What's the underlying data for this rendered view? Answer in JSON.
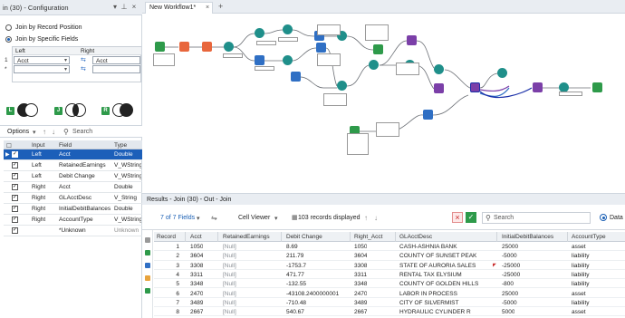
{
  "config": {
    "title": "in (30) - Configuration",
    "radio_record": "Join by Record Position",
    "radio_fields": "Join by Specific Fields",
    "join_table": {
      "col_left": "Left",
      "col_right": "Right",
      "rows": [
        {
          "num": "1",
          "left": "Acct",
          "right": "Acct"
        },
        {
          "num": "*",
          "left": "",
          "right": ""
        }
      ]
    },
    "venn_tags": [
      "L",
      "J",
      "R"
    ],
    "options_label": "Options",
    "search_label": "Search",
    "field_headers": {
      "input": "Input",
      "field": "Field",
      "type": "Type"
    },
    "fields": [
      {
        "input": "Left",
        "field": "Acct",
        "type": "Double",
        "checked": true,
        "selected": true
      },
      {
        "input": "Left",
        "field": "RetainedEarnings",
        "type": "V_WString",
        "checked": true
      },
      {
        "input": "Left",
        "field": "Debit Change",
        "type": "V_WString",
        "checked": true
      },
      {
        "input": "Right",
        "field": "Acct",
        "type": "Double",
        "checked": true
      },
      {
        "input": "Right",
        "field": "GLAcctDesc",
        "type": "V_String",
        "checked": true
      },
      {
        "input": "Right",
        "field": "InitialDebitBalances",
        "type": "Double",
        "checked": true
      },
      {
        "input": "Right",
        "field": "AccountType",
        "type": "V_WString",
        "checked": true
      },
      {
        "input": "",
        "field": "*Unknown",
        "type": "Unknown",
        "checked": true
      }
    ]
  },
  "tabs": {
    "workflow": "New Workflow1*",
    "add": "+"
  },
  "results": {
    "title": "Results - Join (30) - Out - Join",
    "fields_label": "7 of 7 Fields",
    "viewer_label": "Cell Viewer",
    "records_label": "103 records displayed",
    "search_label": "Search",
    "data_label": "Data",
    "columns": [
      "Record",
      "Acct",
      "RetainedEarnings",
      "Debit Change",
      "Right_Acct",
      "GLAcctDesc",
      "InitialDebitBalances",
      "AccountType"
    ],
    "rows": [
      [
        "1",
        "1050",
        "[Null]",
        "8.69",
        "1050",
        "CASH-ASHNIA BANK",
        "25000",
        "asset"
      ],
      [
        "2",
        "3604",
        "[Null]",
        "211.79",
        "3604",
        "COUNTY OF SUNSET PEAK",
        "-5000",
        "liability"
      ],
      [
        "3",
        "3308",
        "[Null]",
        "-1753.7",
        "3308",
        "STATE OF AURORIA SALES",
        "-25000",
        "liability"
      ],
      [
        "4",
        "3311",
        "[Null]",
        "471.77",
        "3311",
        "RENTAL TAX ELYSIUM",
        "-25000",
        "liability"
      ],
      [
        "5",
        "3348",
        "[Null]",
        "-132.55",
        "3348",
        "COUNTY OF GOLDEN HILLS",
        "-800",
        "liability"
      ],
      [
        "6",
        "2470",
        "[Null]",
        "-43108.2400000001",
        "2470",
        "LABOR IN PROCESS",
        "25000",
        "asset"
      ],
      [
        "7",
        "3489",
        "[Null]",
        "-710.48",
        "3489",
        "CITY OF SILVERMIST",
        "-5000",
        "liability"
      ],
      [
        "8",
        "2667",
        "[Null]",
        "540.67",
        "2667",
        "HYDRAULIC CYLINDER R",
        "5000",
        "asset"
      ]
    ]
  },
  "colors": {
    "accent": "#1c5fb9",
    "join_purple": "#7b3fa8",
    "input_green": "#2e9a4a",
    "prep_blue": "#2f6fc4",
    "formula_teal": "#1f8f8a",
    "output_orange": "#e8663c"
  }
}
